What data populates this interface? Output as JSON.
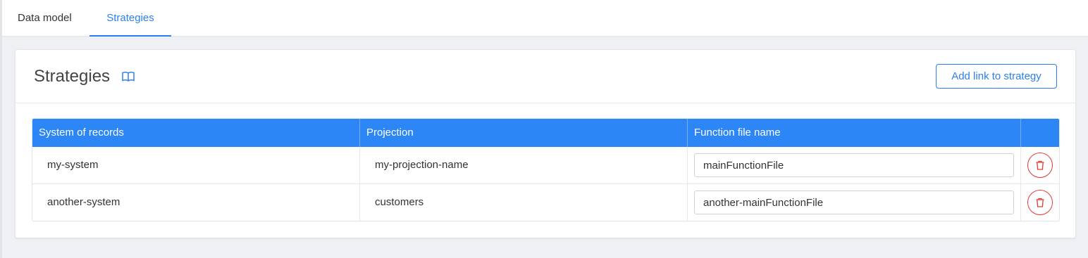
{
  "tabs": [
    {
      "label": "Data model",
      "active": false
    },
    {
      "label": "Strategies",
      "active": true
    }
  ],
  "card": {
    "title": "Strategies",
    "add_button_label": "Add link to strategy"
  },
  "table": {
    "headers": [
      "System of records",
      "Projection",
      "Function file name",
      ""
    ],
    "rows": [
      {
        "system": "my-system",
        "projection": "my-projection-name",
        "function_file": "mainFunctionFile"
      },
      {
        "system": "another-system",
        "projection": "customers",
        "function_file": "another-mainFunctionFile"
      }
    ]
  },
  "icons": {
    "docs": "book-icon",
    "delete": "trash-icon"
  },
  "colors": {
    "accent": "#2d7ff0",
    "header_bg": "#2d86f5",
    "danger": "#e53935",
    "page_bg": "#eef0f3"
  }
}
